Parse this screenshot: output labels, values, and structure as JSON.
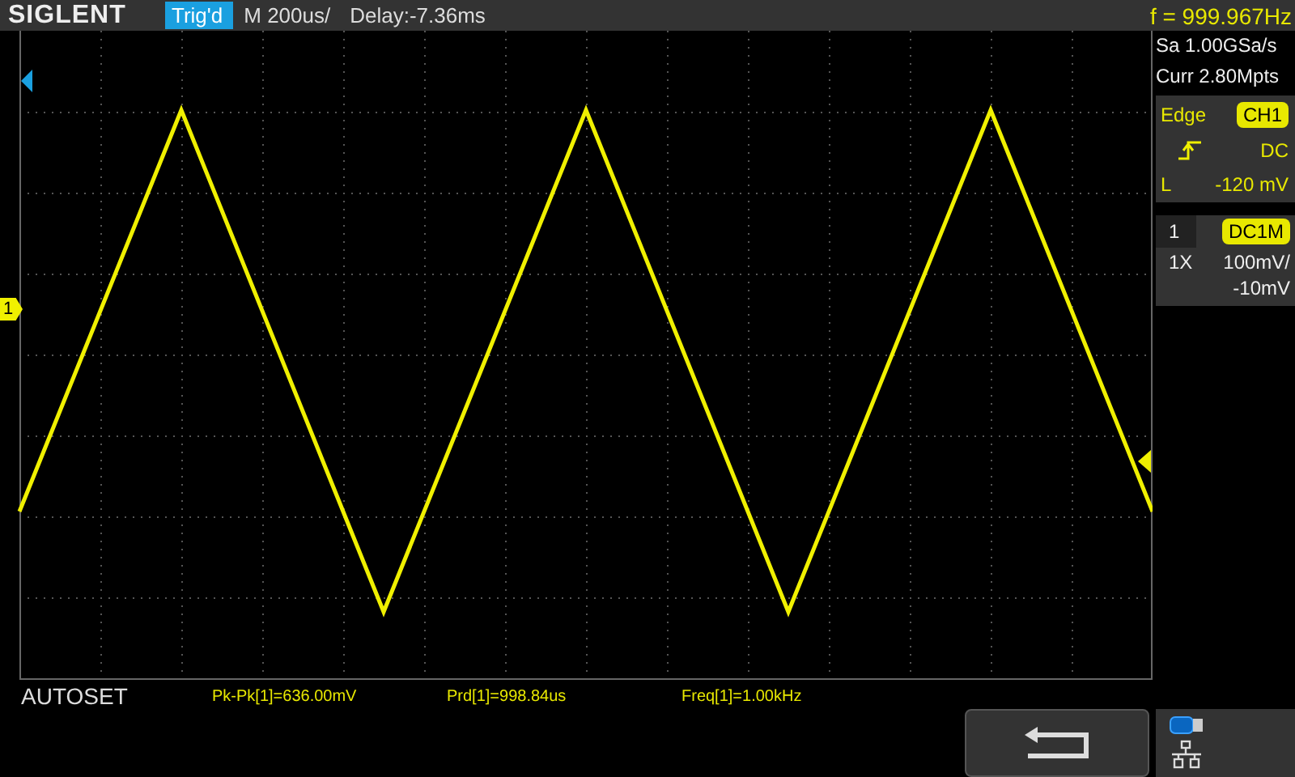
{
  "header": {
    "logo": "SIGLENT",
    "status": "Trig'd",
    "timebase": "M 200us/",
    "delay": "Delay:-7.36ms",
    "frequency": "f = 999.967Hz"
  },
  "acquisition": {
    "sample_rate": "Sa 1.00GSa/s",
    "memory": "Curr 2.80Mpts"
  },
  "trigger": {
    "type": "Edge",
    "source": "CH1",
    "coupling": "DC",
    "level_label": "L",
    "level_reading": "-120 mV"
  },
  "channel": {
    "number": "1",
    "coupling": "DC1M",
    "probe": "1X",
    "scale": "100mV/",
    "offset": "-10mV"
  },
  "channel_marker": "1",
  "footer": {
    "mode": "AUTOSET",
    "measurements": [
      "Pk-Pk[1]=636.00mV",
      "Prd[1]=998.84us",
      "Freq[1]=1.00kHz"
    ]
  }
}
